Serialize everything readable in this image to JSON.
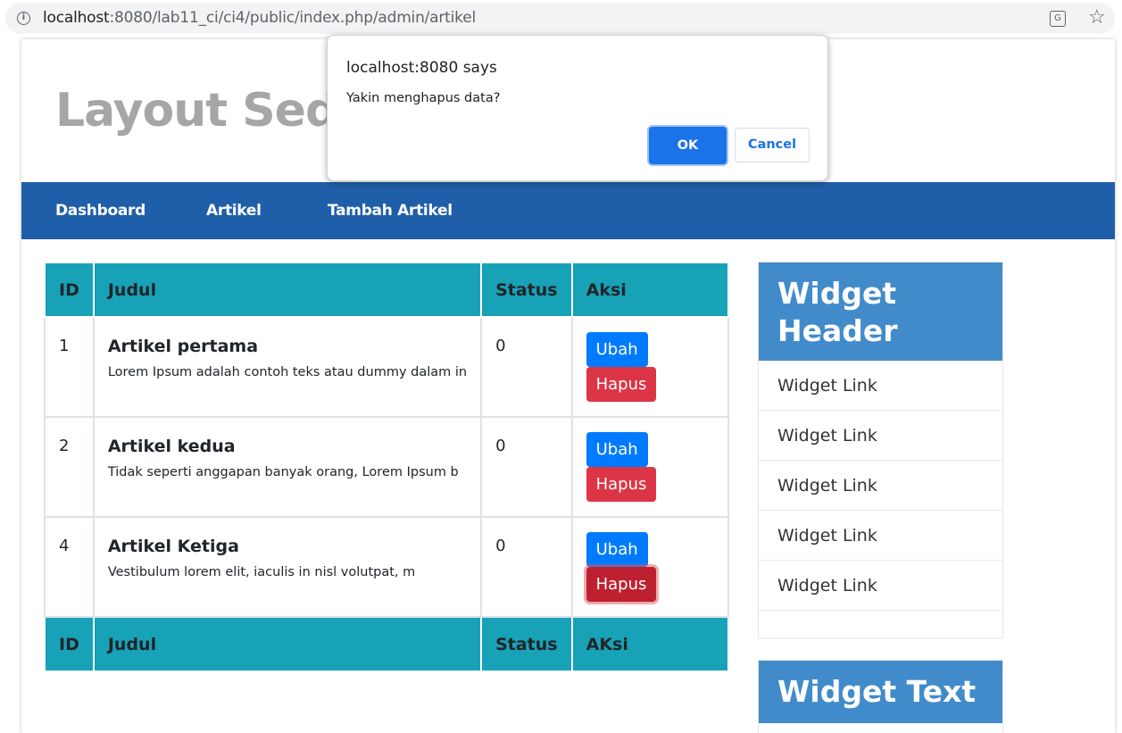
{
  "browser": {
    "url_host": "localhost",
    "url_rest": ":8080/lab11_ci/ci4/public/index.php/admin/artikel",
    "info_icon": "info-icon",
    "translate_icon": "translate-icon",
    "bookmark_icon": "star-icon"
  },
  "site": {
    "title": "Layout Sederhana"
  },
  "nav": {
    "items": [
      "Dashboard",
      "Artikel",
      "Tambah Artikel"
    ]
  },
  "table": {
    "headers": [
      "ID",
      "Judul",
      "Status",
      "Aksi"
    ],
    "footers": [
      "ID",
      "Judul",
      "Status",
      "AKsi"
    ],
    "rows": [
      {
        "id": "1",
        "title": "Artikel pertama",
        "excerpt": "Lorem Ipsum adalah contoh teks atau dummy dalam in",
        "status": "0",
        "edit": "Ubah",
        "delete": "Hapus"
      },
      {
        "id": "2",
        "title": "Artikel kedua",
        "excerpt": "Tidak seperti anggapan banyak orang, Lorem Ipsum b",
        "status": "0",
        "edit": "Ubah",
        "delete": "Hapus"
      },
      {
        "id": "4",
        "title": "Artikel Ketiga",
        "excerpt": "Vestibulum lorem elit, iaculis in nisl volutpat, m",
        "status": "0",
        "edit": "Ubah",
        "delete": "Hapus"
      }
    ]
  },
  "sidebar": {
    "widget1_header": "Widget Header",
    "links": [
      "Widget Link",
      "Widget Link",
      "Widget Link",
      "Widget Link",
      "Widget Link"
    ],
    "widget2_header": "Widget Text"
  },
  "dialog": {
    "title": "localhost:8080 says",
    "message": "Yakin menghapus data?",
    "ok": "OK",
    "cancel": "Cancel"
  },
  "colors": {
    "navbar": "#1f5faa",
    "table_header": "#17a2b8",
    "btn_edit": "#007bff",
    "btn_delete": "#dc3545",
    "widget_header": "#428bca",
    "dialog_ok": "#1a73e8"
  }
}
